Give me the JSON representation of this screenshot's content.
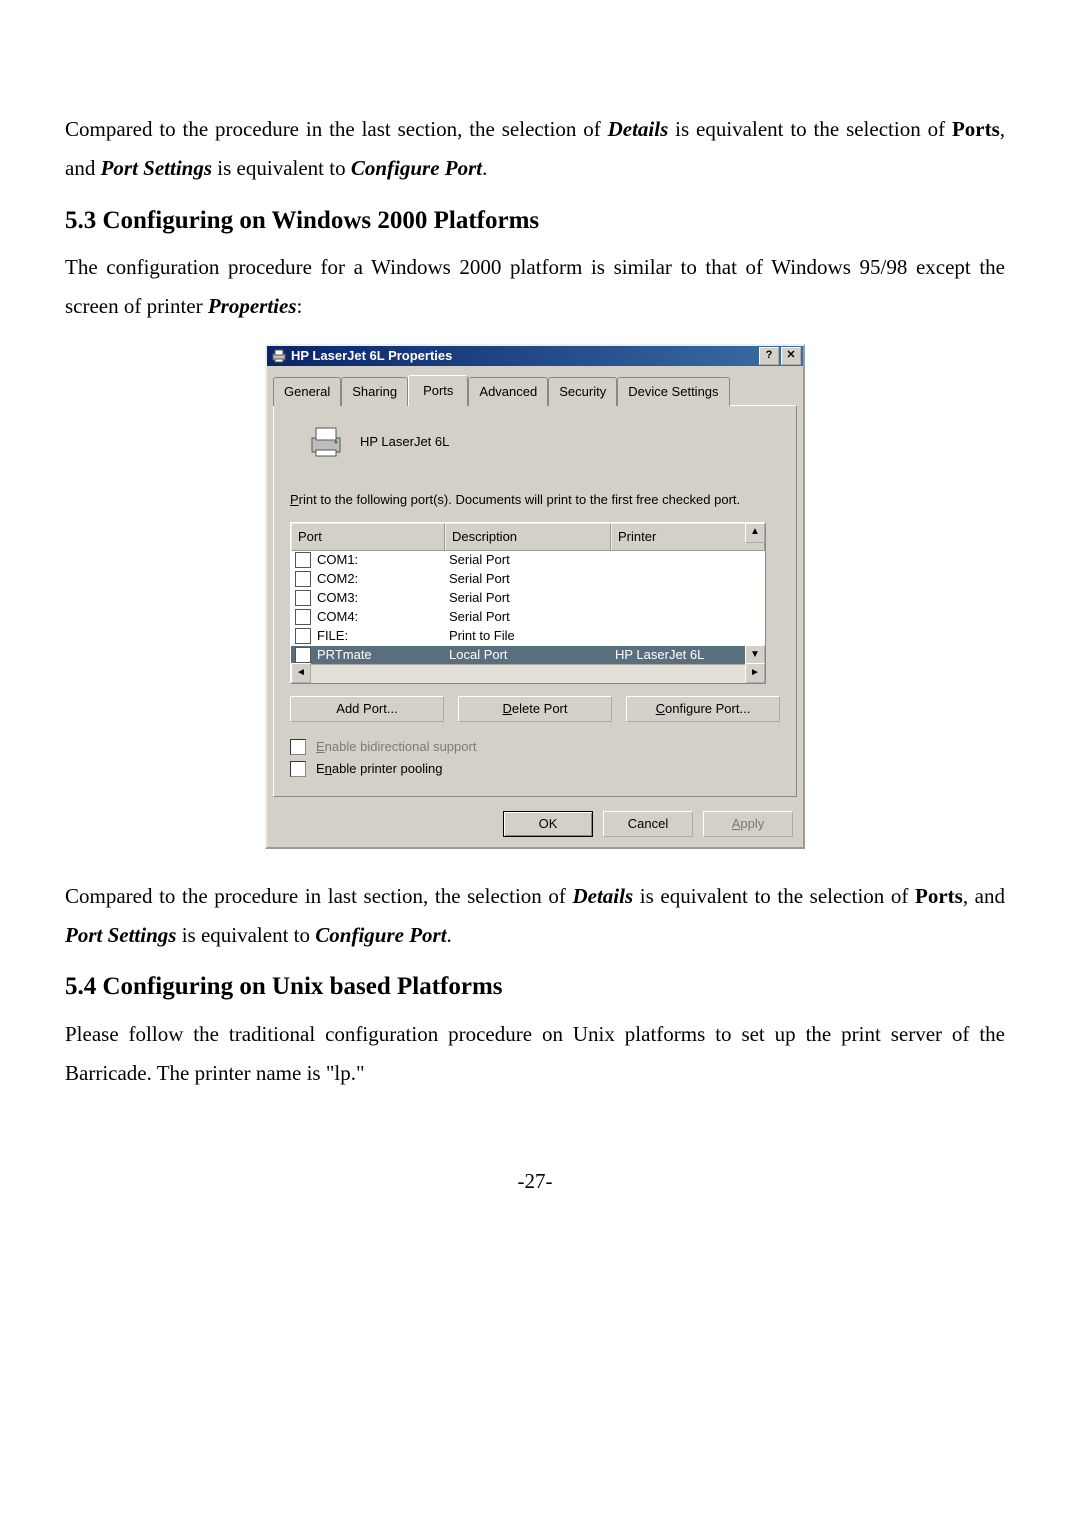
{
  "para1_a": "Compared to the procedure in the last section, the selection of ",
  "para1_details": "Details",
  "para1_b": " is equivalent to the selection of ",
  "para1_ports": "Ports",
  "para1_c": ", and ",
  "para1_portsettings": "Port Settings",
  "para1_d": " is equivalent to ",
  "para1_confport": "Configure Port",
  "para1_e": ".",
  "h53": "5.3 Configuring on Windows 2000 Platforms",
  "para2_a": "The configuration procedure for a Windows 2000 platform is similar to that of Windows 95/98 except the screen of printer ",
  "para2_props": "Properties",
  "para2_end": ":",
  "dialog": {
    "title": "HP LaserJet 6L Properties",
    "help_btn": "?",
    "close_btn": "✕",
    "tabs": {
      "general": "General",
      "sharing": "Sharing",
      "ports": "Ports",
      "advanced": "Advanced",
      "security": "Security",
      "device": "Device Settings"
    },
    "printer_name": "HP LaserJet 6L",
    "instruct_a": "P",
    "instruct_b": "rint to the following port(s). Documents will print to the first free checked port.",
    "cols": {
      "port": "Port",
      "desc": "Description",
      "prn": "Printer"
    },
    "rows": [
      {
        "checked": false,
        "port": "COM1:",
        "desc": "Serial Port",
        "prn": ""
      },
      {
        "checked": false,
        "port": "COM2:",
        "desc": "Serial Port",
        "prn": ""
      },
      {
        "checked": false,
        "port": "COM3:",
        "desc": "Serial Port",
        "prn": ""
      },
      {
        "checked": false,
        "port": "COM4:",
        "desc": "Serial Port",
        "prn": ""
      },
      {
        "checked": false,
        "port": "FILE:",
        "desc": "Print to File",
        "prn": ""
      },
      {
        "checked": true,
        "port": "PRTmate",
        "desc": "Local Port",
        "prn": "HP LaserJet 6L",
        "selected": true
      }
    ],
    "btn_add": "Add Port...",
    "btn_del": "Delete Port",
    "btn_conf": "Configure Port...",
    "chk_bidi": "Enable bidirectional support",
    "chk_pool": "Enable printer pooling",
    "ok": "OK",
    "cancel": "Cancel",
    "apply": "Apply"
  },
  "para3_a": "Compared to the procedure in last section, the selection of ",
  "para3_details": "Details",
  "para3_b": " is equivalent to the selection of ",
  "para3_ports": "Ports",
  "para3_c": ", and ",
  "para3_ps": "Port Settings",
  "para3_d": " is equivalent to ",
  "para3_cp": "Configure Port",
  "para3_e": ".",
  "h54": "5.4 Configuring on Unix based Platforms",
  "para4": "Please follow the traditional configuration procedure on Unix platforms to set up the print server of the Barricade. The printer name is \"lp.\"",
  "pagenum": "-27-"
}
